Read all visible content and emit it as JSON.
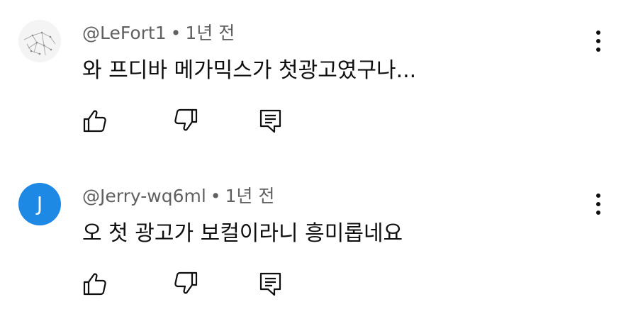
{
  "comments": [
    {
      "author": "@LeFort1",
      "separator": "•",
      "time": "1년 전",
      "text": "와 프디바 메가믹스가 첫광고였구나...",
      "avatar": {
        "type": "image",
        "icon": "sketch-avatar"
      }
    },
    {
      "author": "@Jerry-wq6ml",
      "separator": "•",
      "time": "1년 전",
      "text": "오 첫 광고가 보컬이라니 흥미롭네요",
      "avatar": {
        "type": "letter",
        "letter": "J",
        "color": "#1e88e5"
      }
    }
  ],
  "icons": {
    "like": "thumbs-up-icon",
    "dislike": "thumbs-down-icon",
    "reply": "reply-icon",
    "more": "more-vertical-icon"
  },
  "colors": {
    "meta_text": "#606060",
    "body_text": "#0f0f0f",
    "avatar_blue": "#1e88e5"
  }
}
